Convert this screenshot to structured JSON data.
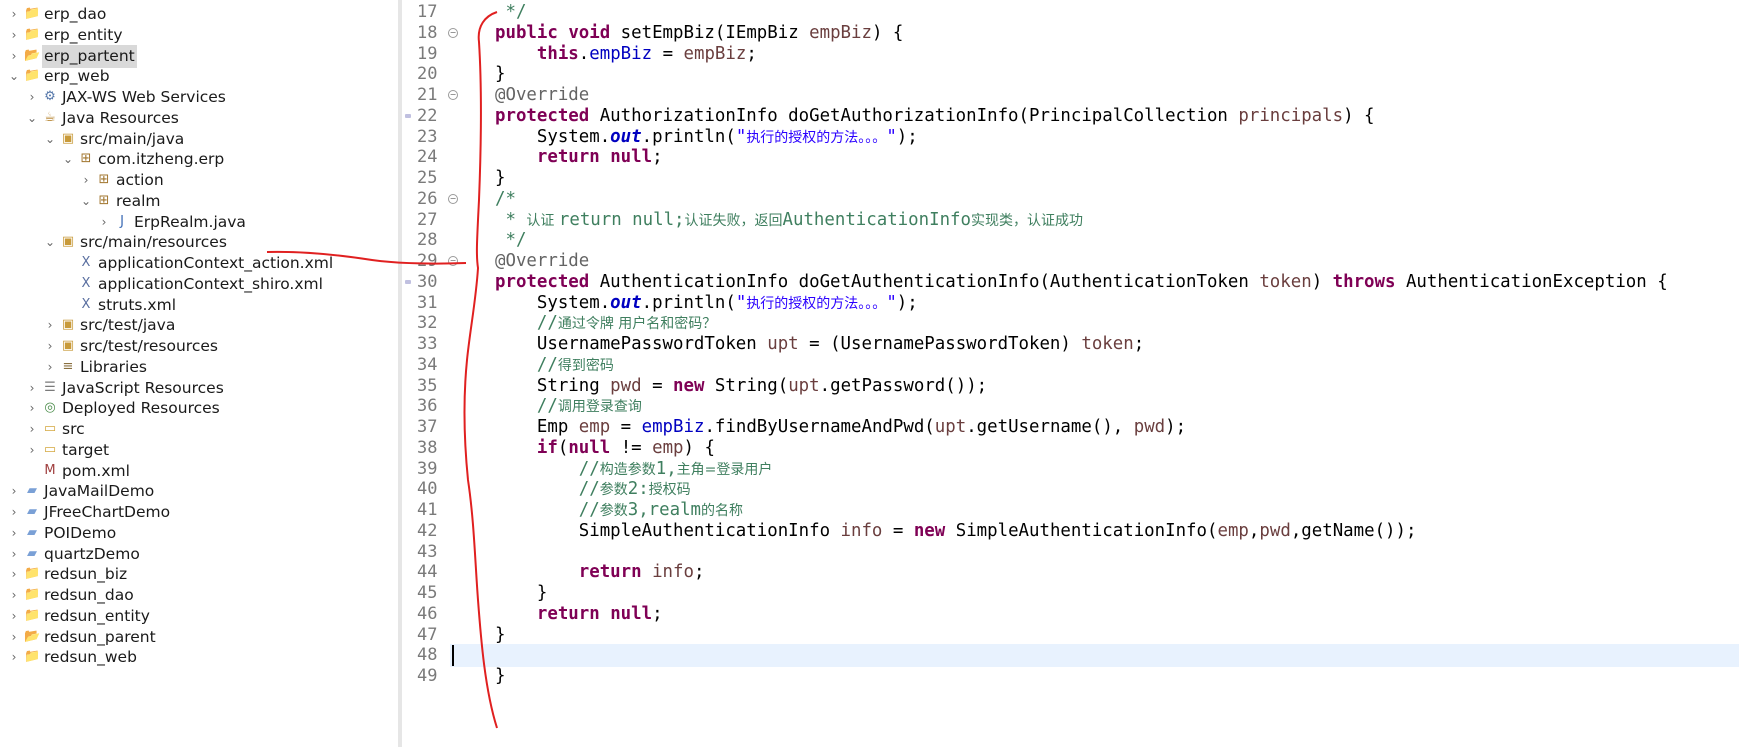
{
  "package_explorer": {
    "items": [
      {
        "label": "erp_dao",
        "icon": "project-icon",
        "arrow": "›",
        "depth": 0,
        "selected": false
      },
      {
        "label": "erp_entity",
        "icon": "project-icon",
        "arrow": "›",
        "depth": 0,
        "selected": false
      },
      {
        "label": "erp_partent",
        "icon": "project-open-icon",
        "arrow": "›",
        "depth": 0,
        "selected": true
      },
      {
        "label": "erp_web",
        "icon": "project-icon",
        "arrow": "⌄",
        "depth": 0,
        "selected": false
      },
      {
        "label": "JAX-WS Web Services",
        "icon": "webservice-icon",
        "arrow": "›",
        "depth": 1,
        "selected": false
      },
      {
        "label": "Java Resources",
        "icon": "java-resources-icon",
        "arrow": "⌄",
        "depth": 1,
        "selected": false
      },
      {
        "label": "src/main/java",
        "icon": "source-folder-icon",
        "arrow": "⌄",
        "depth": 2,
        "selected": false
      },
      {
        "label": "com.itzheng.erp",
        "icon": "package-icon",
        "arrow": "⌄",
        "depth": 3,
        "selected": false
      },
      {
        "label": "action",
        "icon": "package-icon",
        "arrow": "›",
        "depth": 4,
        "selected": false
      },
      {
        "label": "realm",
        "icon": "package-icon",
        "arrow": "⌄",
        "depth": 4,
        "selected": false
      },
      {
        "label": "ErpRealm.java",
        "icon": "java-file-icon",
        "arrow": "›",
        "depth": 5,
        "selected": false
      },
      {
        "label": "src/main/resources",
        "icon": "source-folder-icon",
        "arrow": "⌄",
        "depth": 2,
        "selected": false
      },
      {
        "label": "applicationContext_action.xml",
        "icon": "xml-file-icon",
        "arrow": "",
        "depth": 3,
        "selected": false
      },
      {
        "label": "applicationContext_shiro.xml",
        "icon": "xml-file-icon",
        "arrow": "",
        "depth": 3,
        "selected": false
      },
      {
        "label": "struts.xml",
        "icon": "xml-file-icon",
        "arrow": "",
        "depth": 3,
        "selected": false
      },
      {
        "label": "src/test/java",
        "icon": "source-folder-icon",
        "arrow": "›",
        "depth": 2,
        "selected": false
      },
      {
        "label": "src/test/resources",
        "icon": "source-folder-icon",
        "arrow": "›",
        "depth": 2,
        "selected": false
      },
      {
        "label": "Libraries",
        "icon": "library-icon",
        "arrow": "›",
        "depth": 2,
        "selected": false
      },
      {
        "label": "JavaScript Resources",
        "icon": "javascript-icon",
        "arrow": "›",
        "depth": 1,
        "selected": false
      },
      {
        "label": "Deployed Resources",
        "icon": "deployed-icon",
        "arrow": "›",
        "depth": 1,
        "selected": false
      },
      {
        "label": "src",
        "icon": "folder-icon",
        "arrow": "›",
        "depth": 1,
        "selected": false
      },
      {
        "label": "target",
        "icon": "folder-icon",
        "arrow": "›",
        "depth": 1,
        "selected": false
      },
      {
        "label": "pom.xml",
        "icon": "maven-file-icon",
        "arrow": "",
        "depth": 1,
        "selected": false
      },
      {
        "label": "JavaMailDemo",
        "icon": "project-closed-icon",
        "arrow": "›",
        "depth": 0,
        "selected": false
      },
      {
        "label": "JFreeChartDemo",
        "icon": "project-closed-icon",
        "arrow": "›",
        "depth": 0,
        "selected": false
      },
      {
        "label": "POIDemo",
        "icon": "project-closed-icon",
        "arrow": "›",
        "depth": 0,
        "selected": false
      },
      {
        "label": "quartzDemo",
        "icon": "project-closed-icon",
        "arrow": "›",
        "depth": 0,
        "selected": false
      },
      {
        "label": "redsun_biz",
        "icon": "project-icon",
        "arrow": "›",
        "depth": 0,
        "selected": false
      },
      {
        "label": "redsun_dao",
        "icon": "project-icon",
        "arrow": "›",
        "depth": 0,
        "selected": false
      },
      {
        "label": "redsun_entity",
        "icon": "project-icon",
        "arrow": "›",
        "depth": 0,
        "selected": false
      },
      {
        "label": "redsun_parent",
        "icon": "project-open-icon",
        "arrow": "›",
        "depth": 0,
        "selected": false
      },
      {
        "label": "redsun_web",
        "icon": "project-icon",
        "arrow": "›",
        "depth": 0,
        "selected": false
      }
    ]
  },
  "editor": {
    "current_line": "48",
    "colors": {
      "keyword": "#7f0055",
      "field": "#0000c0",
      "comment": "#3f7f5f",
      "string": "#2a00ff",
      "annotation": "#646464",
      "variable": "#6a3e3e",
      "current_line_bg": "#e8f2fe"
    },
    "lines": [
      {
        "num": "17",
        "fold": false,
        "tokens": [
          [
            "cm",
            " */"
          ]
        ]
      },
      {
        "num": "18",
        "fold": true,
        "tokens": [
          [
            "kw",
            "public"
          ],
          [
            "",
            " "
          ],
          [
            "kw",
            "void"
          ],
          [
            "",
            " setEmpBiz(IEmpBiz "
          ],
          [
            "vr",
            "empBiz"
          ],
          [
            "",
            ") {"
          ]
        ]
      },
      {
        "num": "19",
        "fold": false,
        "tokens": [
          [
            "",
            "    "
          ],
          [
            "kw",
            "this"
          ],
          [
            "",
            "."
          ],
          [
            "fld",
            "empBiz"
          ],
          [
            "",
            " = "
          ],
          [
            "vr",
            "empBiz"
          ],
          [
            "",
            ";"
          ]
        ]
      },
      {
        "num": "20",
        "fold": false,
        "tokens": [
          [
            "",
            "}"
          ]
        ]
      },
      {
        "num": "21",
        "fold": true,
        "tokens": [
          [
            "an",
            "@Override"
          ]
        ]
      },
      {
        "num": "22",
        "fold": false,
        "tokens": [
          [
            "kw",
            "protected"
          ],
          [
            "",
            " AuthorizationInfo doGetAuthorizationInfo(PrincipalCollection "
          ],
          [
            "vr",
            "principals"
          ],
          [
            "",
            ") {"
          ]
        ]
      },
      {
        "num": "23",
        "fold": false,
        "tokens": [
          [
            "",
            "    System."
          ],
          [
            "st",
            "out"
          ],
          [
            "",
            ".println("
          ],
          [
            "str",
            "\""
          ],
          [
            "str cjk",
            "执行的授权的方法。。。"
          ],
          [
            "str",
            "\""
          ],
          [
            "",
            ");"
          ]
        ]
      },
      {
        "num": "24",
        "fold": false,
        "tokens": [
          [
            "",
            "    "
          ],
          [
            "kw",
            "return"
          ],
          [
            "",
            " "
          ],
          [
            "kw",
            "null"
          ],
          [
            "",
            ";"
          ]
        ]
      },
      {
        "num": "25",
        "fold": false,
        "tokens": [
          [
            "",
            "}"
          ]
        ]
      },
      {
        "num": "26",
        "fold": true,
        "tokens": [
          [
            "cm",
            "/*"
          ]
        ]
      },
      {
        "num": "27",
        "fold": false,
        "tokens": [
          [
            "cm",
            " * "
          ],
          [
            "cm cjk",
            "认证 "
          ],
          [
            "cm",
            "return null;"
          ],
          [
            "cm cjk",
            "认证失败，返回"
          ],
          [
            "cm",
            "AuthenticationInfo"
          ],
          [
            "cm cjk",
            "实现类，认证成功"
          ]
        ]
      },
      {
        "num": "28",
        "fold": false,
        "tokens": [
          [
            "cm",
            " */"
          ]
        ]
      },
      {
        "num": "29",
        "fold": true,
        "tokens": [
          [
            "an",
            "@Override"
          ]
        ]
      },
      {
        "num": "30",
        "fold": false,
        "tokens": [
          [
            "kw",
            "protected"
          ],
          [
            "",
            " AuthenticationInfo doGetAuthenticationInfo(AuthenticationToken "
          ],
          [
            "vr",
            "token"
          ],
          [
            "",
            ") "
          ],
          [
            "kw",
            "throws"
          ],
          [
            "",
            " AuthenticationException {"
          ]
        ]
      },
      {
        "num": "31",
        "fold": false,
        "tokens": [
          [
            "",
            "    System."
          ],
          [
            "st",
            "out"
          ],
          [
            "",
            ".println("
          ],
          [
            "str",
            "\""
          ],
          [
            "str cjk",
            "执行的授权的方法。。。"
          ],
          [
            "str",
            "\""
          ],
          [
            "",
            ");"
          ]
        ]
      },
      {
        "num": "32",
        "fold": false,
        "tokens": [
          [
            "",
            "    "
          ],
          [
            "cm",
            "//"
          ],
          [
            "cm cjk",
            "通过令牌 用户名和密码？"
          ]
        ]
      },
      {
        "num": "33",
        "fold": false,
        "tokens": [
          [
            "",
            "    UsernamePasswordToken "
          ],
          [
            "vr",
            "upt"
          ],
          [
            "",
            " = (UsernamePasswordToken) "
          ],
          [
            "vr",
            "token"
          ],
          [
            "",
            ";"
          ]
        ]
      },
      {
        "num": "34",
        "fold": false,
        "tokens": [
          [
            "",
            "    "
          ],
          [
            "cm",
            "//"
          ],
          [
            "cm cjk",
            "得到密码"
          ]
        ]
      },
      {
        "num": "35",
        "fold": false,
        "tokens": [
          [
            "",
            "    String "
          ],
          [
            "vr",
            "pwd"
          ],
          [
            "",
            " = "
          ],
          [
            "kw",
            "new"
          ],
          [
            "",
            " String("
          ],
          [
            "vr",
            "upt"
          ],
          [
            "",
            ".getPassword());"
          ]
        ]
      },
      {
        "num": "36",
        "fold": false,
        "tokens": [
          [
            "",
            "    "
          ],
          [
            "cm",
            "//"
          ],
          [
            "cm cjk",
            "调用登录查询"
          ]
        ]
      },
      {
        "num": "37",
        "fold": false,
        "tokens": [
          [
            "",
            "    Emp "
          ],
          [
            "vr",
            "emp"
          ],
          [
            "",
            " = "
          ],
          [
            "fld",
            "empBiz"
          ],
          [
            "",
            ".findByUsernameAndPwd("
          ],
          [
            "vr",
            "upt"
          ],
          [
            "",
            ".getUsername(), "
          ],
          [
            "vr",
            "pwd"
          ],
          [
            "",
            ");"
          ]
        ]
      },
      {
        "num": "38",
        "fold": false,
        "tokens": [
          [
            "",
            "    "
          ],
          [
            "kw",
            "if"
          ],
          [
            "",
            "("
          ],
          [
            "kw",
            "null"
          ],
          [
            "",
            " != "
          ],
          [
            "vr",
            "emp"
          ],
          [
            "",
            ") {"
          ]
        ]
      },
      {
        "num": "39",
        "fold": false,
        "tokens": [
          [
            "",
            "        "
          ],
          [
            "cm",
            "//"
          ],
          [
            "cm cjk",
            "构造参数"
          ],
          [
            "cm",
            "1,"
          ],
          [
            "cm cjk",
            "主角=登录用户"
          ]
        ]
      },
      {
        "num": "40",
        "fold": false,
        "tokens": [
          [
            "",
            "        "
          ],
          [
            "cm",
            "//"
          ],
          [
            "cm cjk",
            "参数"
          ],
          [
            "cm",
            "2:"
          ],
          [
            "cm cjk",
            "授权码"
          ]
        ]
      },
      {
        "num": "41",
        "fold": false,
        "tokens": [
          [
            "",
            "        "
          ],
          [
            "cm",
            "//"
          ],
          [
            "cm cjk",
            "参数"
          ],
          [
            "cm",
            "3,realm"
          ],
          [
            "cm cjk",
            "的名称"
          ]
        ]
      },
      {
        "num": "42",
        "fold": false,
        "tokens": [
          [
            "",
            "        SimpleAuthenticationInfo "
          ],
          [
            "vr",
            "info"
          ],
          [
            "",
            " = "
          ],
          [
            "kw",
            "new"
          ],
          [
            "",
            " SimpleAuthenticationInfo("
          ],
          [
            "vr",
            "emp"
          ],
          [
            "",
            ","
          ],
          [
            "vr",
            "pwd"
          ],
          [
            "",
            ",getName());"
          ]
        ]
      },
      {
        "num": "43",
        "fold": false,
        "tokens": [
          [
            "",
            ""
          ]
        ]
      },
      {
        "num": "44",
        "fold": false,
        "tokens": [
          [
            "",
            "        "
          ],
          [
            "kw",
            "return"
          ],
          [
            "",
            " "
          ],
          [
            "vr",
            "info"
          ],
          [
            "",
            ";"
          ]
        ]
      },
      {
        "num": "45",
        "fold": false,
        "tokens": [
          [
            "",
            "    }"
          ]
        ]
      },
      {
        "num": "46",
        "fold": false,
        "tokens": [
          [
            "",
            "    "
          ],
          [
            "kw",
            "return"
          ],
          [
            "",
            " "
          ],
          [
            "kw",
            "null"
          ],
          [
            "",
            ";"
          ]
        ]
      },
      {
        "num": "47",
        "fold": false,
        "tokens": [
          [
            "",
            "}"
          ]
        ]
      },
      {
        "num": "48",
        "fold": false,
        "tokens": [
          [
            "",
            ""
          ]
        ]
      },
      {
        "num": "49",
        "fold": false,
        "tokens": [
          [
            "",
            "}"
          ]
        ]
      }
    ]
  },
  "annotation_color": "#e02020"
}
